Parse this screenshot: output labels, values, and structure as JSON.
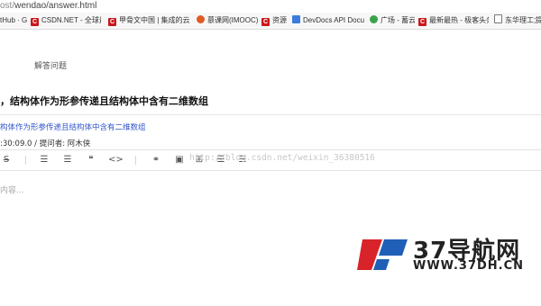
{
  "browser": {
    "url_prefix": "ost/",
    "url_path": "wendao/answer.html",
    "bookmarks": [
      {
        "label": "tHub · G",
        "icon": "none"
      },
      {
        "label": "CSDN.NET - 全球最",
        "icon": "csdn-icon"
      },
      {
        "label": "甲骨文中国 | 集成的云",
        "icon": "csdn-icon"
      },
      {
        "label": "慕课网(IMOOC)-程序",
        "icon": "imooc-icon"
      },
      {
        "label": "资源",
        "icon": "csdn-icon"
      },
      {
        "label": "DevDocs API Docum",
        "icon": "devdocs-icon"
      },
      {
        "label": "广场 - 蓄云",
        "icon": "cloud-icon"
      },
      {
        "label": "最新最热 - 极客头条",
        "icon": "csdn-icon"
      },
      {
        "label": "东华理工大学",
        "icon": "doc-icon"
      },
      {
        "label": "提",
        "icon": "none"
      }
    ]
  },
  "page": {
    "breadcrumb": "解答问题",
    "question_title": "，结构体作为形参传递且结构体中含有二维数组",
    "question_link": "构体作为形参传递且结构体中含有二维数组",
    "question_meta": ":30:09.0 / 提问者: 阿木侠"
  },
  "editor": {
    "toolbar": [
      {
        "name": "strikethrough-icon",
        "glyph": "S"
      },
      {
        "name": "ordered-list-icon",
        "glyph": "☰"
      },
      {
        "name": "unordered-list-icon",
        "glyph": "☰"
      },
      {
        "name": "quote-icon",
        "glyph": "❝"
      },
      {
        "name": "code-icon",
        "glyph": "<>"
      },
      {
        "name": "link-icon",
        "glyph": "⚭"
      },
      {
        "name": "image-icon",
        "glyph": "▣"
      },
      {
        "name": "unknown-icon",
        "glyph": "⊞"
      },
      {
        "name": "align-icon",
        "glyph": "☰"
      },
      {
        "name": "table-icon",
        "glyph": "☰"
      }
    ],
    "placeholder": "内容...",
    "watermark": "http://blog.csdn.net/weixin_36380516"
  },
  "logo": {
    "main": "37导航网",
    "sub": "WWW.37DH.CN",
    "colors": {
      "red": "#d8232a",
      "blue": "#1f5fb8"
    }
  }
}
